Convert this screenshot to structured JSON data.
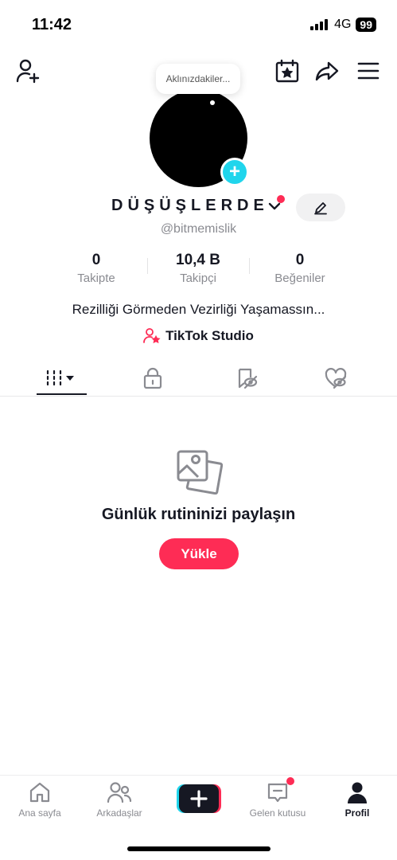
{
  "status_bar": {
    "time": "11:42",
    "network": "4G",
    "battery": "99"
  },
  "bubble": {
    "text": "Aklınızdakiler..."
  },
  "profile": {
    "display_name": "DÜŞÜŞLERDE",
    "username": "@bitmemislik",
    "bio": "Rezilliği Görmeden Vezirliği Yaşamassın...",
    "studio_label": "TikTok Studio"
  },
  "stats": [
    {
      "value": "0",
      "label": "Takipte"
    },
    {
      "value": "10,4 B",
      "label": "Takipçi"
    },
    {
      "value": "0",
      "label": "Beğeniler"
    }
  ],
  "empty_state": {
    "title": "Günlük rutininizi paylaşın",
    "button_label": "Yükle"
  },
  "nav": [
    {
      "label": "Ana sayfa",
      "icon": "home-icon"
    },
    {
      "label": "Arkadaşlar",
      "icon": "friends-icon"
    },
    {
      "label": "",
      "icon": "create-icon"
    },
    {
      "label": "Gelen kutusu",
      "icon": "inbox-icon"
    },
    {
      "label": "Profil",
      "icon": "profile-icon"
    }
  ],
  "colors": {
    "accent": "#fe2c55",
    "cyan": "#20d5ec",
    "text": "#161823",
    "muted": "#8a8b91"
  }
}
